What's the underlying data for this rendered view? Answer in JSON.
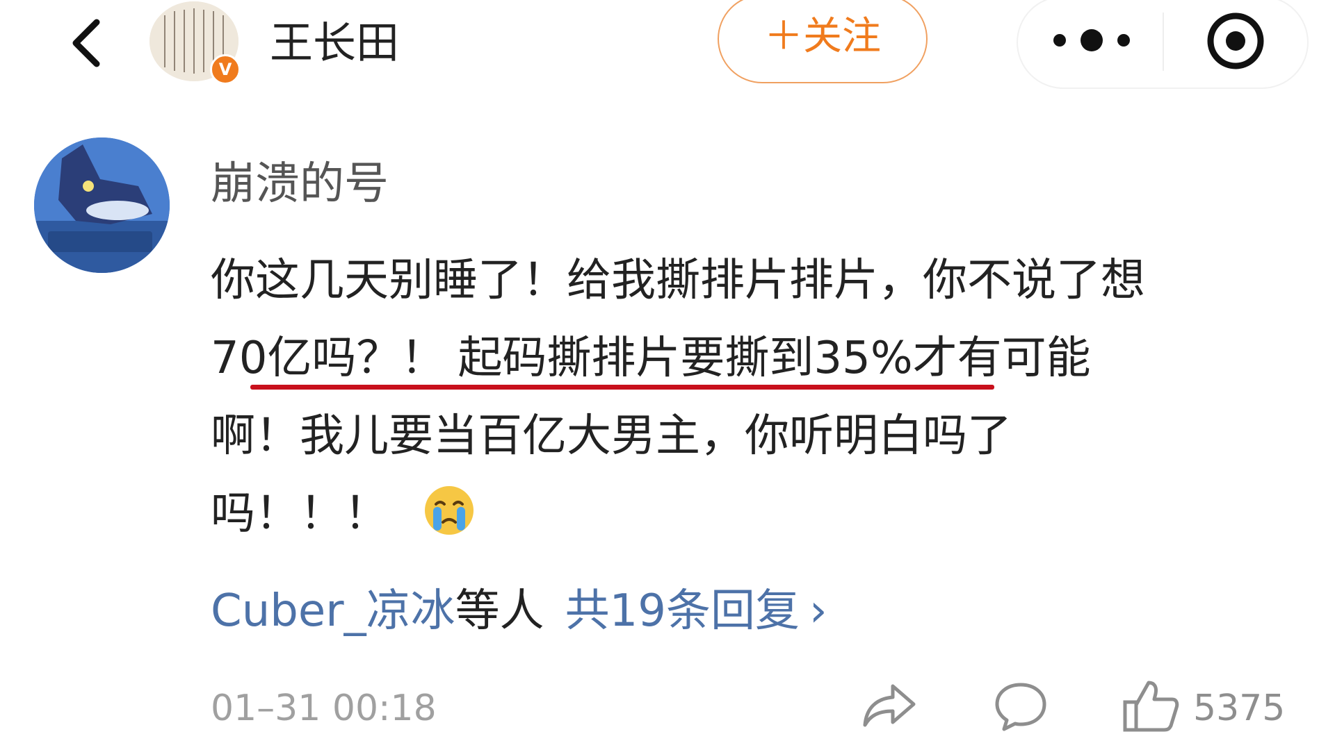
{
  "header": {
    "account_name": "王长田",
    "verified_badge": "V",
    "follow_label": "＋关注"
  },
  "comment": {
    "author": "崩溃的号",
    "lines": [
      "你这几天别睡了！给我撕排片排片，你不说了想",
      "70亿吗？！",
      "起码撕排片要撕到35%才有可能",
      "啊！我儿要当百亿大男主，你听明白吗了",
      "吗！！！"
    ],
    "emoji": "crying-face",
    "replies": {
      "user": "Cuber_凉冰",
      "suffix": "等人",
      "count_label": "共19条回复",
      "chevron": "›"
    },
    "timestamp": "01–31 00:18",
    "like_count": "5375"
  },
  "colors": {
    "accent_orange": "#f07b1d",
    "link_blue": "#4d72a8",
    "underline_red": "#c8101c",
    "muted_gray": "#a0a0a0"
  },
  "icons": [
    "back-arrow-icon",
    "more-dots-icon",
    "close-target-icon",
    "share-icon",
    "comment-bubble-icon",
    "thumbs-up-icon"
  ]
}
